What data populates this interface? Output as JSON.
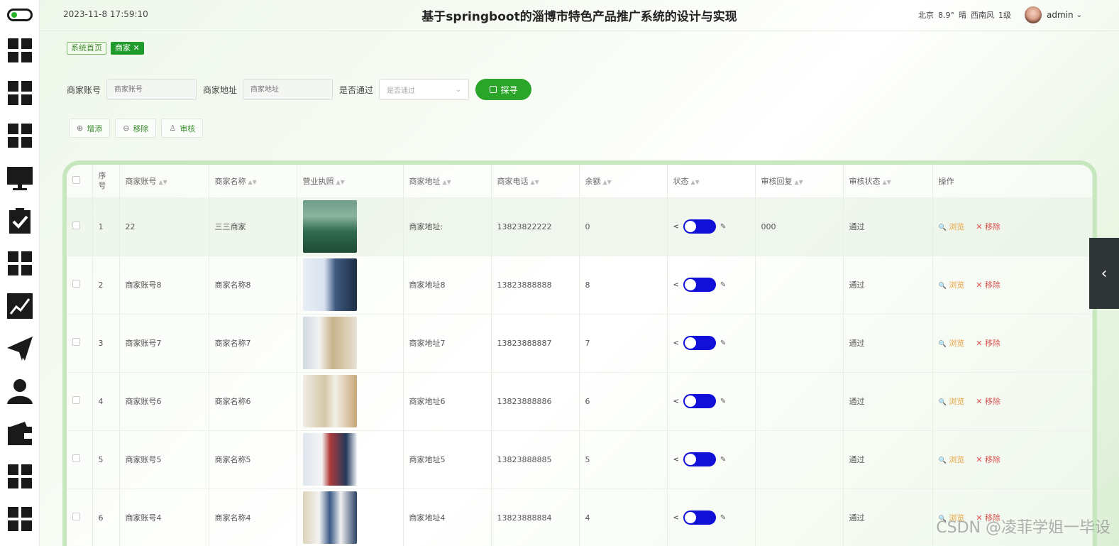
{
  "header": {
    "datetime": "2023-11-8 17:59:10",
    "title": "基于springboot的淄博市特色产品推广系统的设计与实现",
    "weather": {
      "city": "北京",
      "temp": "8.9°",
      "condition": "晴",
      "wind": "西南风",
      "level": "1级"
    },
    "user": "admin",
    "user_caret": "⌄"
  },
  "tags": [
    {
      "label": "系统首页"
    },
    {
      "label": "商家 ✕"
    }
  ],
  "search": {
    "account_label": "商家账号",
    "account_placeholder": "商家账号",
    "address_label": "商家地址",
    "address_placeholder": "商家地址",
    "pass_label": "是否通过",
    "pass_placeholder": "是否通过",
    "button": "探寻"
  },
  "actions": {
    "add": "增添",
    "remove": "移除",
    "audit": "审核"
  },
  "columns": {
    "index": "序号",
    "account": "商家账号",
    "name": "商家名称",
    "license": "营业执照",
    "address": "商家地址",
    "phone": "商家电话",
    "balance": "余额",
    "status": "状态",
    "reply": "审核回复",
    "audit_status": "审核状态",
    "ops": "操作"
  },
  "ops": {
    "view": "浏览",
    "delete": "移除",
    "view_icon": "🔍",
    "delete_icon": "✕"
  },
  "rows": [
    {
      "index": "1",
      "account": "22",
      "name": "三三商家",
      "address": "商家地址:",
      "phone": "13823822222",
      "balance": "0",
      "reply": "000",
      "audit_status": "通过"
    },
    {
      "index": "2",
      "account": "商家账号8",
      "name": "商家名称8",
      "address": "商家地址8",
      "phone": "13823888888",
      "balance": "8",
      "reply": "",
      "audit_status": "通过"
    },
    {
      "index": "3",
      "account": "商家账号7",
      "name": "商家名称7",
      "address": "商家地址7",
      "phone": "13823888887",
      "balance": "7",
      "reply": "",
      "audit_status": "通过"
    },
    {
      "index": "4",
      "account": "商家账号6",
      "name": "商家名称6",
      "address": "商家地址6",
      "phone": "13823888886",
      "balance": "6",
      "reply": "",
      "audit_status": "通过"
    },
    {
      "index": "5",
      "account": "商家账号5",
      "name": "商家名称5",
      "address": "商家地址5",
      "phone": "13823888885",
      "balance": "5",
      "reply": "",
      "audit_status": "通过"
    },
    {
      "index": "6",
      "account": "商家账号4",
      "name": "商家名称4",
      "address": "商家地址4",
      "phone": "13823888884",
      "balance": "4",
      "reply": "",
      "audit_status": "通过"
    }
  ],
  "watermark": "CSDN @凌菲学姐一毕设",
  "colors": {
    "accent": "#2aa52a",
    "switch": "#1010d8",
    "view": "#e6a23c",
    "delete": "#d9534f"
  }
}
